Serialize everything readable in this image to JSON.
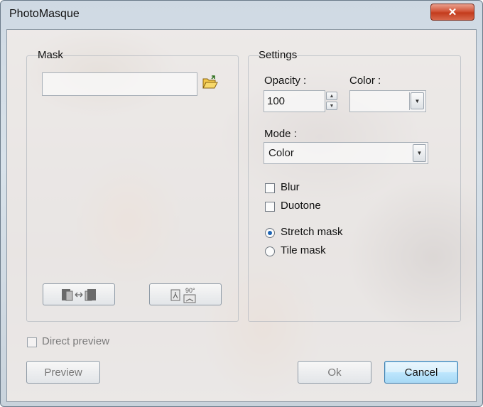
{
  "window": {
    "title": "PhotoMasque",
    "close_glyph": "✕",
    "accent_color": "#c33b1c"
  },
  "mask": {
    "group_label": "Mask",
    "file_value": "",
    "browse_icon": "folder-open-icon",
    "flip_icon": "flip-horizontal-icon",
    "rotate_icon": "rotate-90-icon",
    "rotate_icon_label": "90°"
  },
  "settings": {
    "group_label": "Settings",
    "opacity_label": "Opacity :",
    "opacity_value": "100",
    "color_label": "Color :",
    "color_value": "",
    "mode_label": "Mode :",
    "mode_value": "Color",
    "blur_label": "Blur",
    "blur_checked": false,
    "duotone_label": "Duotone",
    "duotone_checked": false,
    "stretch_label": "Stretch mask",
    "stretch_selected": true,
    "tile_label": "Tile mask",
    "tile_selected": false
  },
  "footer": {
    "direct_preview_label": "Direct preview",
    "direct_preview_checked": false,
    "preview_label": "Preview",
    "ok_label": "Ok",
    "cancel_label": "Cancel"
  }
}
